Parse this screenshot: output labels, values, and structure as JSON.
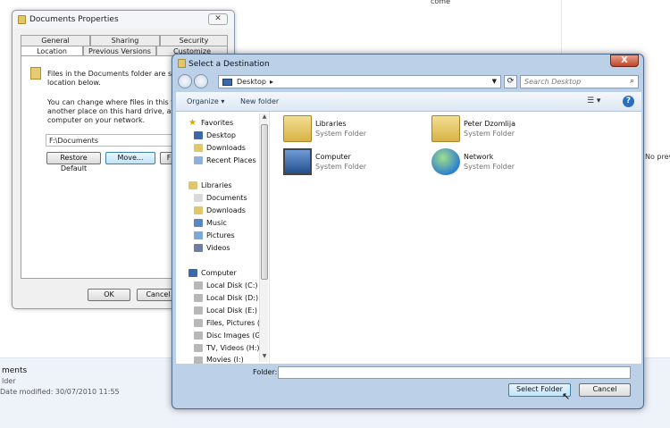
{
  "background": {
    "status_name": "ments",
    "status_type": "lder",
    "status_modified": "Date modified: 30/07/2010 11:55",
    "preview_text": "No prev",
    "top_fragment": "come"
  },
  "properties_dialog": {
    "title": "Documents Properties",
    "close_label": "✕",
    "tabs_row1": [
      "General",
      "Sharing",
      "Security"
    ],
    "tabs_row2": [
      "Location",
      "Previous Versions",
      "Customize"
    ],
    "desc1": "Files in the Documents folder are stored in th location below.",
    "desc2": "You can change where files in this folder are another place on this hard drive, another driv computer on your network.",
    "path_value": "F:\\Documents",
    "restore_label": "Restore Default",
    "move_label": "Move...",
    "find_label": "F",
    "ok_label": "OK",
    "cancel_label": "Cancel"
  },
  "dest_dialog": {
    "title": "Select a Destination",
    "close_label": "X",
    "address": "Desktop",
    "search_placeholder": "Search Desktop",
    "organize_label": "Organize ▾",
    "new_folder_label": "New folder",
    "nav": {
      "favorites": "Favorites",
      "fav_items": [
        "Desktop",
        "Downloads",
        "Recent Places"
      ],
      "libraries": "Libraries",
      "lib_items": [
        "Documents",
        "Downloads",
        "Music",
        "Pictures",
        "Videos"
      ],
      "computer": "Computer",
      "comp_items": [
        "Local Disk (C:)",
        "Local Disk (D:)",
        "Local Disk (E:)",
        "Files, Pictures (F:)",
        "Disc Images (G:)",
        "TV, Videos (H:)",
        "Movies (I:)"
      ]
    },
    "items": [
      {
        "name": "Libraries",
        "type": "System Folder"
      },
      {
        "name": "Peter Dzomlija",
        "type": "System Folder"
      },
      {
        "name": "Computer",
        "type": "System Folder"
      },
      {
        "name": "Network",
        "type": "System Folder"
      }
    ],
    "folder_label": "Folder:",
    "folder_value": "",
    "select_label": "Select Folder",
    "cancel_label": "Cancel"
  },
  "colors": {
    "accent": "#3c7fb1",
    "frame": "#bcd0e8",
    "close_red": "#c2442a"
  }
}
